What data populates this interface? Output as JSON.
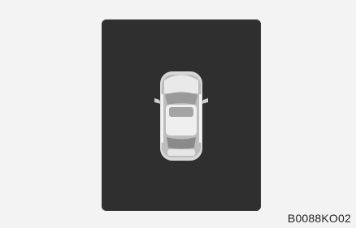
{
  "figure": {
    "code": "B0088KO02"
  },
  "display": {
    "icon": "car-top-view-icon",
    "colors": {
      "background": "#2f2f2f",
      "car_body": "#d8d8d8",
      "car_glass": "#9a9a9a"
    }
  }
}
